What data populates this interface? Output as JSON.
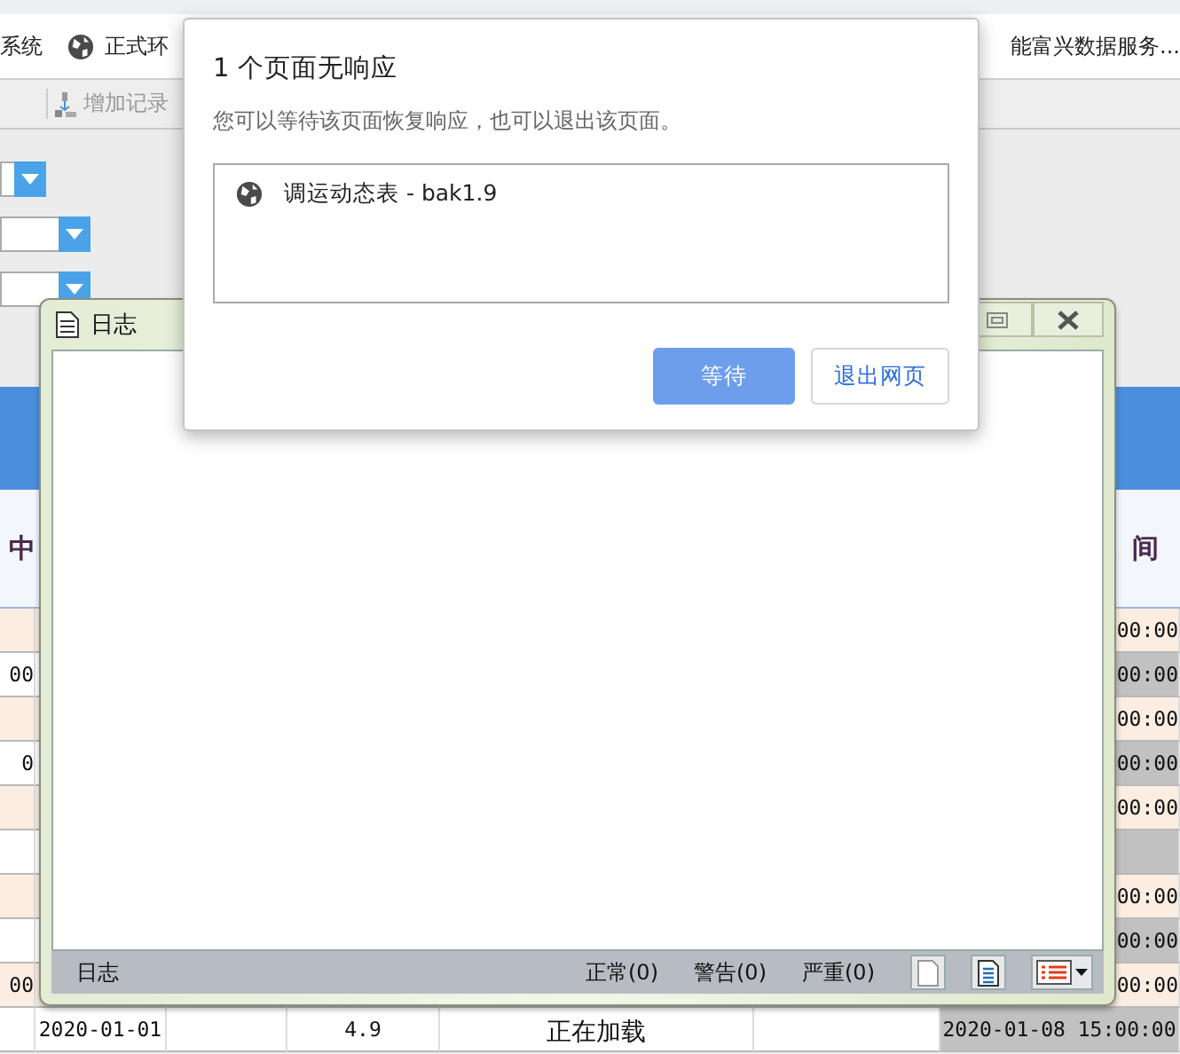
{
  "bookmarks": [
    {
      "label": "系统",
      "icon": false
    },
    {
      "label": "正式环",
      "icon": true
    },
    {
      "label": "能富兴数据服务...",
      "icon": false
    }
  ],
  "toolbar": {
    "add_button": "增加记录"
  },
  "table": {
    "header": {
      "column_1": "中",
      "column_last": "间"
    },
    "rows": [
      {
        "column_1": "",
        "column_last": "00:00"
      },
      {
        "column_1": "00",
        "column_last": "00:00"
      },
      {
        "column_1": "",
        "column_last": "00:00"
      },
      {
        "column_1": "0",
        "column_last": "00:00"
      },
      {
        "column_1": "",
        "column_last": "00:00"
      },
      {
        "column_1": "",
        "column_last": ""
      },
      {
        "column_1": "",
        "column_last": "00:00"
      },
      {
        "column_1": "",
        "column_last": "00:00"
      },
      {
        "column_1": "00",
        "column_last": "00:00"
      }
    ],
    "last_row": {
      "date": "2020-01-01",
      "value": "4.9",
      "status": "正在加载",
      "time": "2020-01-08 15:00:00"
    }
  },
  "log_window": {
    "title": "日志",
    "status": {
      "label": "日志",
      "counts": [
        "正常(0)",
        "警告(0)",
        "严重(0)"
      ]
    }
  },
  "dialog": {
    "title": "1 个页面无响应",
    "message": "您可以等待该页面恢复响应，也可以退出该页面。",
    "pages": [
      "调运动态表 - bak1.9"
    ],
    "buttons": [
      {
        "label": "等待",
        "primary": true
      },
      {
        "label": "退出网页",
        "primary": false
      }
    ]
  }
}
